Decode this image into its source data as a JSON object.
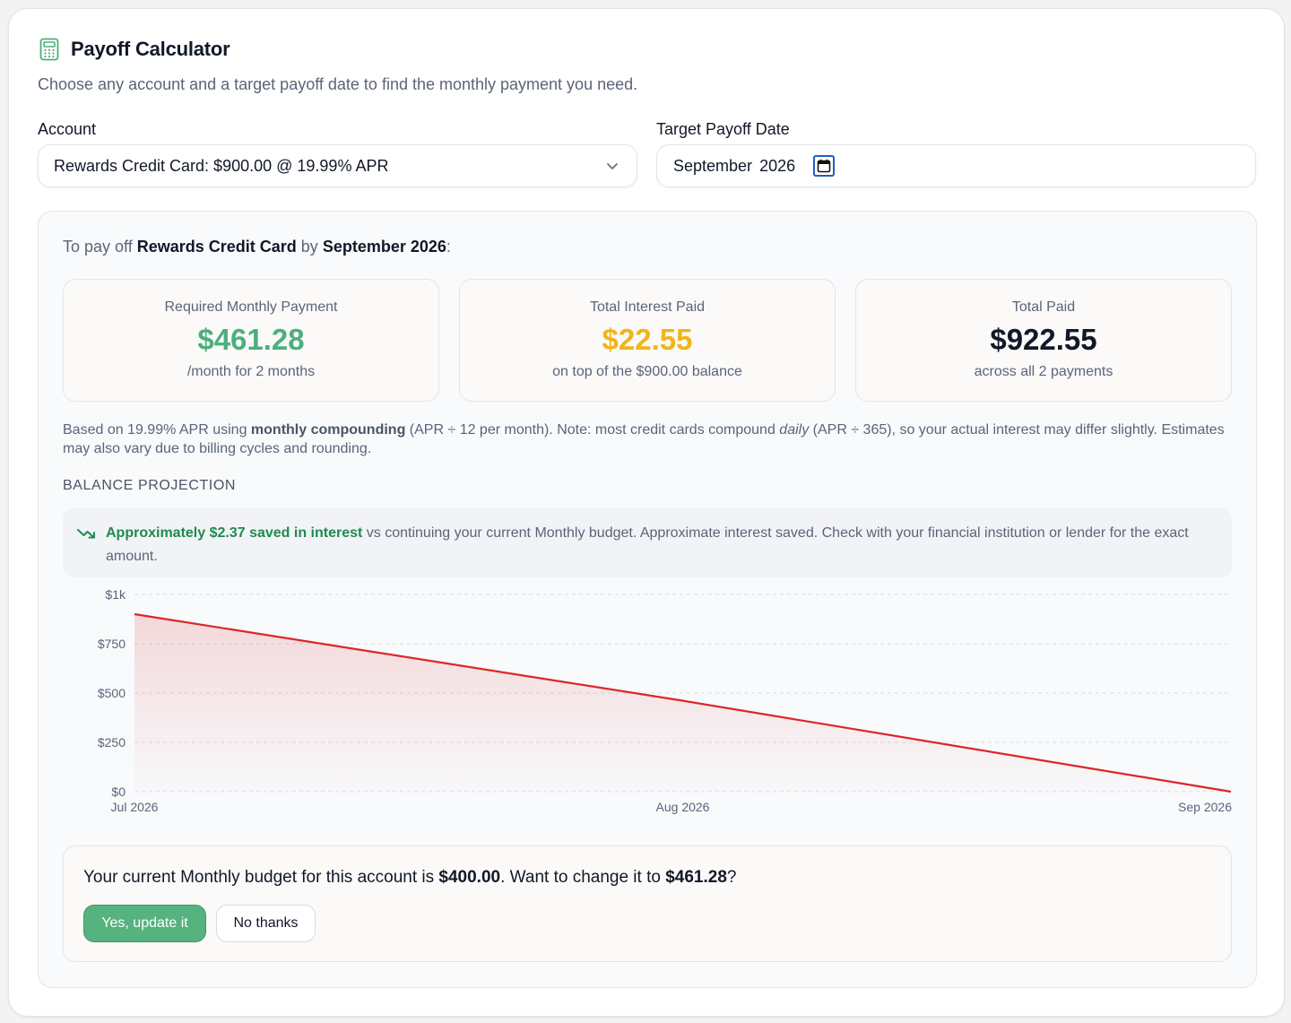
{
  "header": {
    "title": "Payoff Calculator",
    "subtitle": "Choose any account and a target payoff date to find the monthly payment you need."
  },
  "form": {
    "account_label": "Account",
    "account_value": "Rewards Credit Card: $900.00 @ 19.99% APR",
    "date_label": "Target Payoff Date",
    "date_month": "September",
    "date_year": "2026"
  },
  "results": {
    "intro_prefix": "To pay off ",
    "intro_account": "Rewards Credit Card",
    "intro_by": " by ",
    "intro_date": "September 2026",
    "intro_suffix": ":",
    "stats": [
      {
        "label": "Required Monthly Payment",
        "value": "$461.28",
        "sub": "/month for 2 months",
        "color": "#4caf7d"
      },
      {
        "label": "Total Interest Paid",
        "value": "$22.55",
        "sub": "on top of the $900.00 balance",
        "color": "#efb51c"
      },
      {
        "label": "Total Paid",
        "value": "$922.55",
        "sub": "across all 2 payments",
        "color": "#111827"
      }
    ],
    "note_p1": "Based on 19.99% APR using ",
    "note_b1": "monthly compounding",
    "note_p2": " (APR ÷ 12 per month). Note: most credit cards compound ",
    "note_i1": "daily",
    "note_p3": " (APR ÷ 365), so your actual interest may differ slightly. Estimates may also vary due to billing cycles and rounding.",
    "section_title": "BALANCE PROJECTION",
    "saved_bold": "Approximately $2.37 saved in interest",
    "saved_rest": " vs continuing your current Monthly budget. Approximate interest saved. Check with your financial institution or lender for the exact amount."
  },
  "chart_data": {
    "type": "area",
    "x": [
      "Jul 2026",
      "Aug 2026",
      "Sep 2026"
    ],
    "series": [
      {
        "values": [
          900,
          461.27,
          0
        ],
        "color": "#dc2626"
      }
    ],
    "ylim": [
      0,
      1000
    ],
    "yticks": [
      0,
      250,
      500,
      750,
      1000
    ],
    "ytick_labels": [
      "$0",
      "$250",
      "$500",
      "$750",
      "$1k"
    ],
    "xtick_labels": [
      "Jul 2026",
      "Aug 2026",
      "Sep 2026"
    ],
    "grid": true,
    "title": "",
    "xlabel": "",
    "ylabel": ""
  },
  "budget": {
    "q_p1": "Your current Monthly budget for this account is ",
    "q_current": "$400.00",
    "q_p2": ". Want to change it to ",
    "q_new": "$461.28",
    "q_p3": "?",
    "yes_label": "Yes, update it",
    "no_label": "No thanks"
  },
  "icons": {
    "header": "calculator-icon",
    "select": "chevron-down-icon",
    "date": "calendar-icon",
    "saved": "trending-down-icon"
  },
  "colors": {
    "accent_green": "#4caf7d",
    "saved_green": "#1e8a4f",
    "warning_yellow": "#efb51c",
    "line_red": "#dc2626"
  }
}
